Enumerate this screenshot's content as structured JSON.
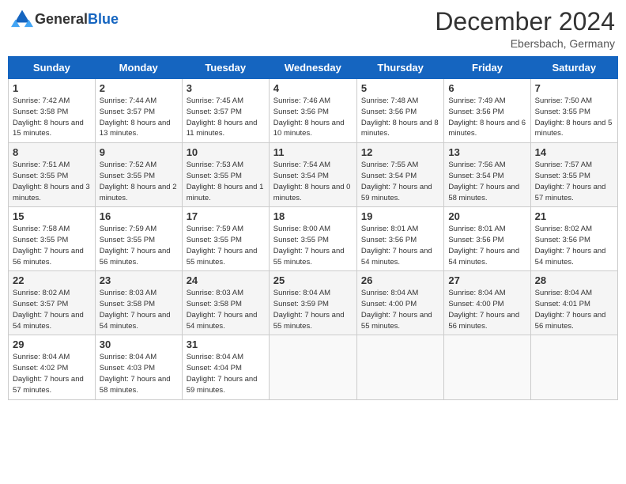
{
  "header": {
    "logo_general": "General",
    "logo_blue": "Blue",
    "month_title": "December 2024",
    "location": "Ebersbach, Germany"
  },
  "weekdays": [
    "Sunday",
    "Monday",
    "Tuesday",
    "Wednesday",
    "Thursday",
    "Friday",
    "Saturday"
  ],
  "weeks": [
    [
      {
        "day": "1",
        "sunrise": "Sunrise: 7:42 AM",
        "sunset": "Sunset: 3:58 PM",
        "daylight": "Daylight: 8 hours and 15 minutes."
      },
      {
        "day": "2",
        "sunrise": "Sunrise: 7:44 AM",
        "sunset": "Sunset: 3:57 PM",
        "daylight": "Daylight: 8 hours and 13 minutes."
      },
      {
        "day": "3",
        "sunrise": "Sunrise: 7:45 AM",
        "sunset": "Sunset: 3:57 PM",
        "daylight": "Daylight: 8 hours and 11 minutes."
      },
      {
        "day": "4",
        "sunrise": "Sunrise: 7:46 AM",
        "sunset": "Sunset: 3:56 PM",
        "daylight": "Daylight: 8 hours and 10 minutes."
      },
      {
        "day": "5",
        "sunrise": "Sunrise: 7:48 AM",
        "sunset": "Sunset: 3:56 PM",
        "daylight": "Daylight: 8 hours and 8 minutes."
      },
      {
        "day": "6",
        "sunrise": "Sunrise: 7:49 AM",
        "sunset": "Sunset: 3:56 PM",
        "daylight": "Daylight: 8 hours and 6 minutes."
      },
      {
        "day": "7",
        "sunrise": "Sunrise: 7:50 AM",
        "sunset": "Sunset: 3:55 PM",
        "daylight": "Daylight: 8 hours and 5 minutes."
      }
    ],
    [
      {
        "day": "8",
        "sunrise": "Sunrise: 7:51 AM",
        "sunset": "Sunset: 3:55 PM",
        "daylight": "Daylight: 8 hours and 3 minutes."
      },
      {
        "day": "9",
        "sunrise": "Sunrise: 7:52 AM",
        "sunset": "Sunset: 3:55 PM",
        "daylight": "Daylight: 8 hours and 2 minutes."
      },
      {
        "day": "10",
        "sunrise": "Sunrise: 7:53 AM",
        "sunset": "Sunset: 3:55 PM",
        "daylight": "Daylight: 8 hours and 1 minute."
      },
      {
        "day": "11",
        "sunrise": "Sunrise: 7:54 AM",
        "sunset": "Sunset: 3:54 PM",
        "daylight": "Daylight: 8 hours and 0 minutes."
      },
      {
        "day": "12",
        "sunrise": "Sunrise: 7:55 AM",
        "sunset": "Sunset: 3:54 PM",
        "daylight": "Daylight: 7 hours and 59 minutes."
      },
      {
        "day": "13",
        "sunrise": "Sunrise: 7:56 AM",
        "sunset": "Sunset: 3:54 PM",
        "daylight": "Daylight: 7 hours and 58 minutes."
      },
      {
        "day": "14",
        "sunrise": "Sunrise: 7:57 AM",
        "sunset": "Sunset: 3:55 PM",
        "daylight": "Daylight: 7 hours and 57 minutes."
      }
    ],
    [
      {
        "day": "15",
        "sunrise": "Sunrise: 7:58 AM",
        "sunset": "Sunset: 3:55 PM",
        "daylight": "Daylight: 7 hours and 56 minutes."
      },
      {
        "day": "16",
        "sunrise": "Sunrise: 7:59 AM",
        "sunset": "Sunset: 3:55 PM",
        "daylight": "Daylight: 7 hours and 56 minutes."
      },
      {
        "day": "17",
        "sunrise": "Sunrise: 7:59 AM",
        "sunset": "Sunset: 3:55 PM",
        "daylight": "Daylight: 7 hours and 55 minutes."
      },
      {
        "day": "18",
        "sunrise": "Sunrise: 8:00 AM",
        "sunset": "Sunset: 3:55 PM",
        "daylight": "Daylight: 7 hours and 55 minutes."
      },
      {
        "day": "19",
        "sunrise": "Sunrise: 8:01 AM",
        "sunset": "Sunset: 3:56 PM",
        "daylight": "Daylight: 7 hours and 54 minutes."
      },
      {
        "day": "20",
        "sunrise": "Sunrise: 8:01 AM",
        "sunset": "Sunset: 3:56 PM",
        "daylight": "Daylight: 7 hours and 54 minutes."
      },
      {
        "day": "21",
        "sunrise": "Sunrise: 8:02 AM",
        "sunset": "Sunset: 3:56 PM",
        "daylight": "Daylight: 7 hours and 54 minutes."
      }
    ],
    [
      {
        "day": "22",
        "sunrise": "Sunrise: 8:02 AM",
        "sunset": "Sunset: 3:57 PM",
        "daylight": "Daylight: 7 hours and 54 minutes."
      },
      {
        "day": "23",
        "sunrise": "Sunrise: 8:03 AM",
        "sunset": "Sunset: 3:58 PM",
        "daylight": "Daylight: 7 hours and 54 minutes."
      },
      {
        "day": "24",
        "sunrise": "Sunrise: 8:03 AM",
        "sunset": "Sunset: 3:58 PM",
        "daylight": "Daylight: 7 hours and 54 minutes."
      },
      {
        "day": "25",
        "sunrise": "Sunrise: 8:04 AM",
        "sunset": "Sunset: 3:59 PM",
        "daylight": "Daylight: 7 hours and 55 minutes."
      },
      {
        "day": "26",
        "sunrise": "Sunrise: 8:04 AM",
        "sunset": "Sunset: 4:00 PM",
        "daylight": "Daylight: 7 hours and 55 minutes."
      },
      {
        "day": "27",
        "sunrise": "Sunrise: 8:04 AM",
        "sunset": "Sunset: 4:00 PM",
        "daylight": "Daylight: 7 hours and 56 minutes."
      },
      {
        "day": "28",
        "sunrise": "Sunrise: 8:04 AM",
        "sunset": "Sunset: 4:01 PM",
        "daylight": "Daylight: 7 hours and 56 minutes."
      }
    ],
    [
      {
        "day": "29",
        "sunrise": "Sunrise: 8:04 AM",
        "sunset": "Sunset: 4:02 PM",
        "daylight": "Daylight: 7 hours and 57 minutes."
      },
      {
        "day": "30",
        "sunrise": "Sunrise: 8:04 AM",
        "sunset": "Sunset: 4:03 PM",
        "daylight": "Daylight: 7 hours and 58 minutes."
      },
      {
        "day": "31",
        "sunrise": "Sunrise: 8:04 AM",
        "sunset": "Sunset: 4:04 PM",
        "daylight": "Daylight: 7 hours and 59 minutes."
      },
      null,
      null,
      null,
      null
    ]
  ]
}
